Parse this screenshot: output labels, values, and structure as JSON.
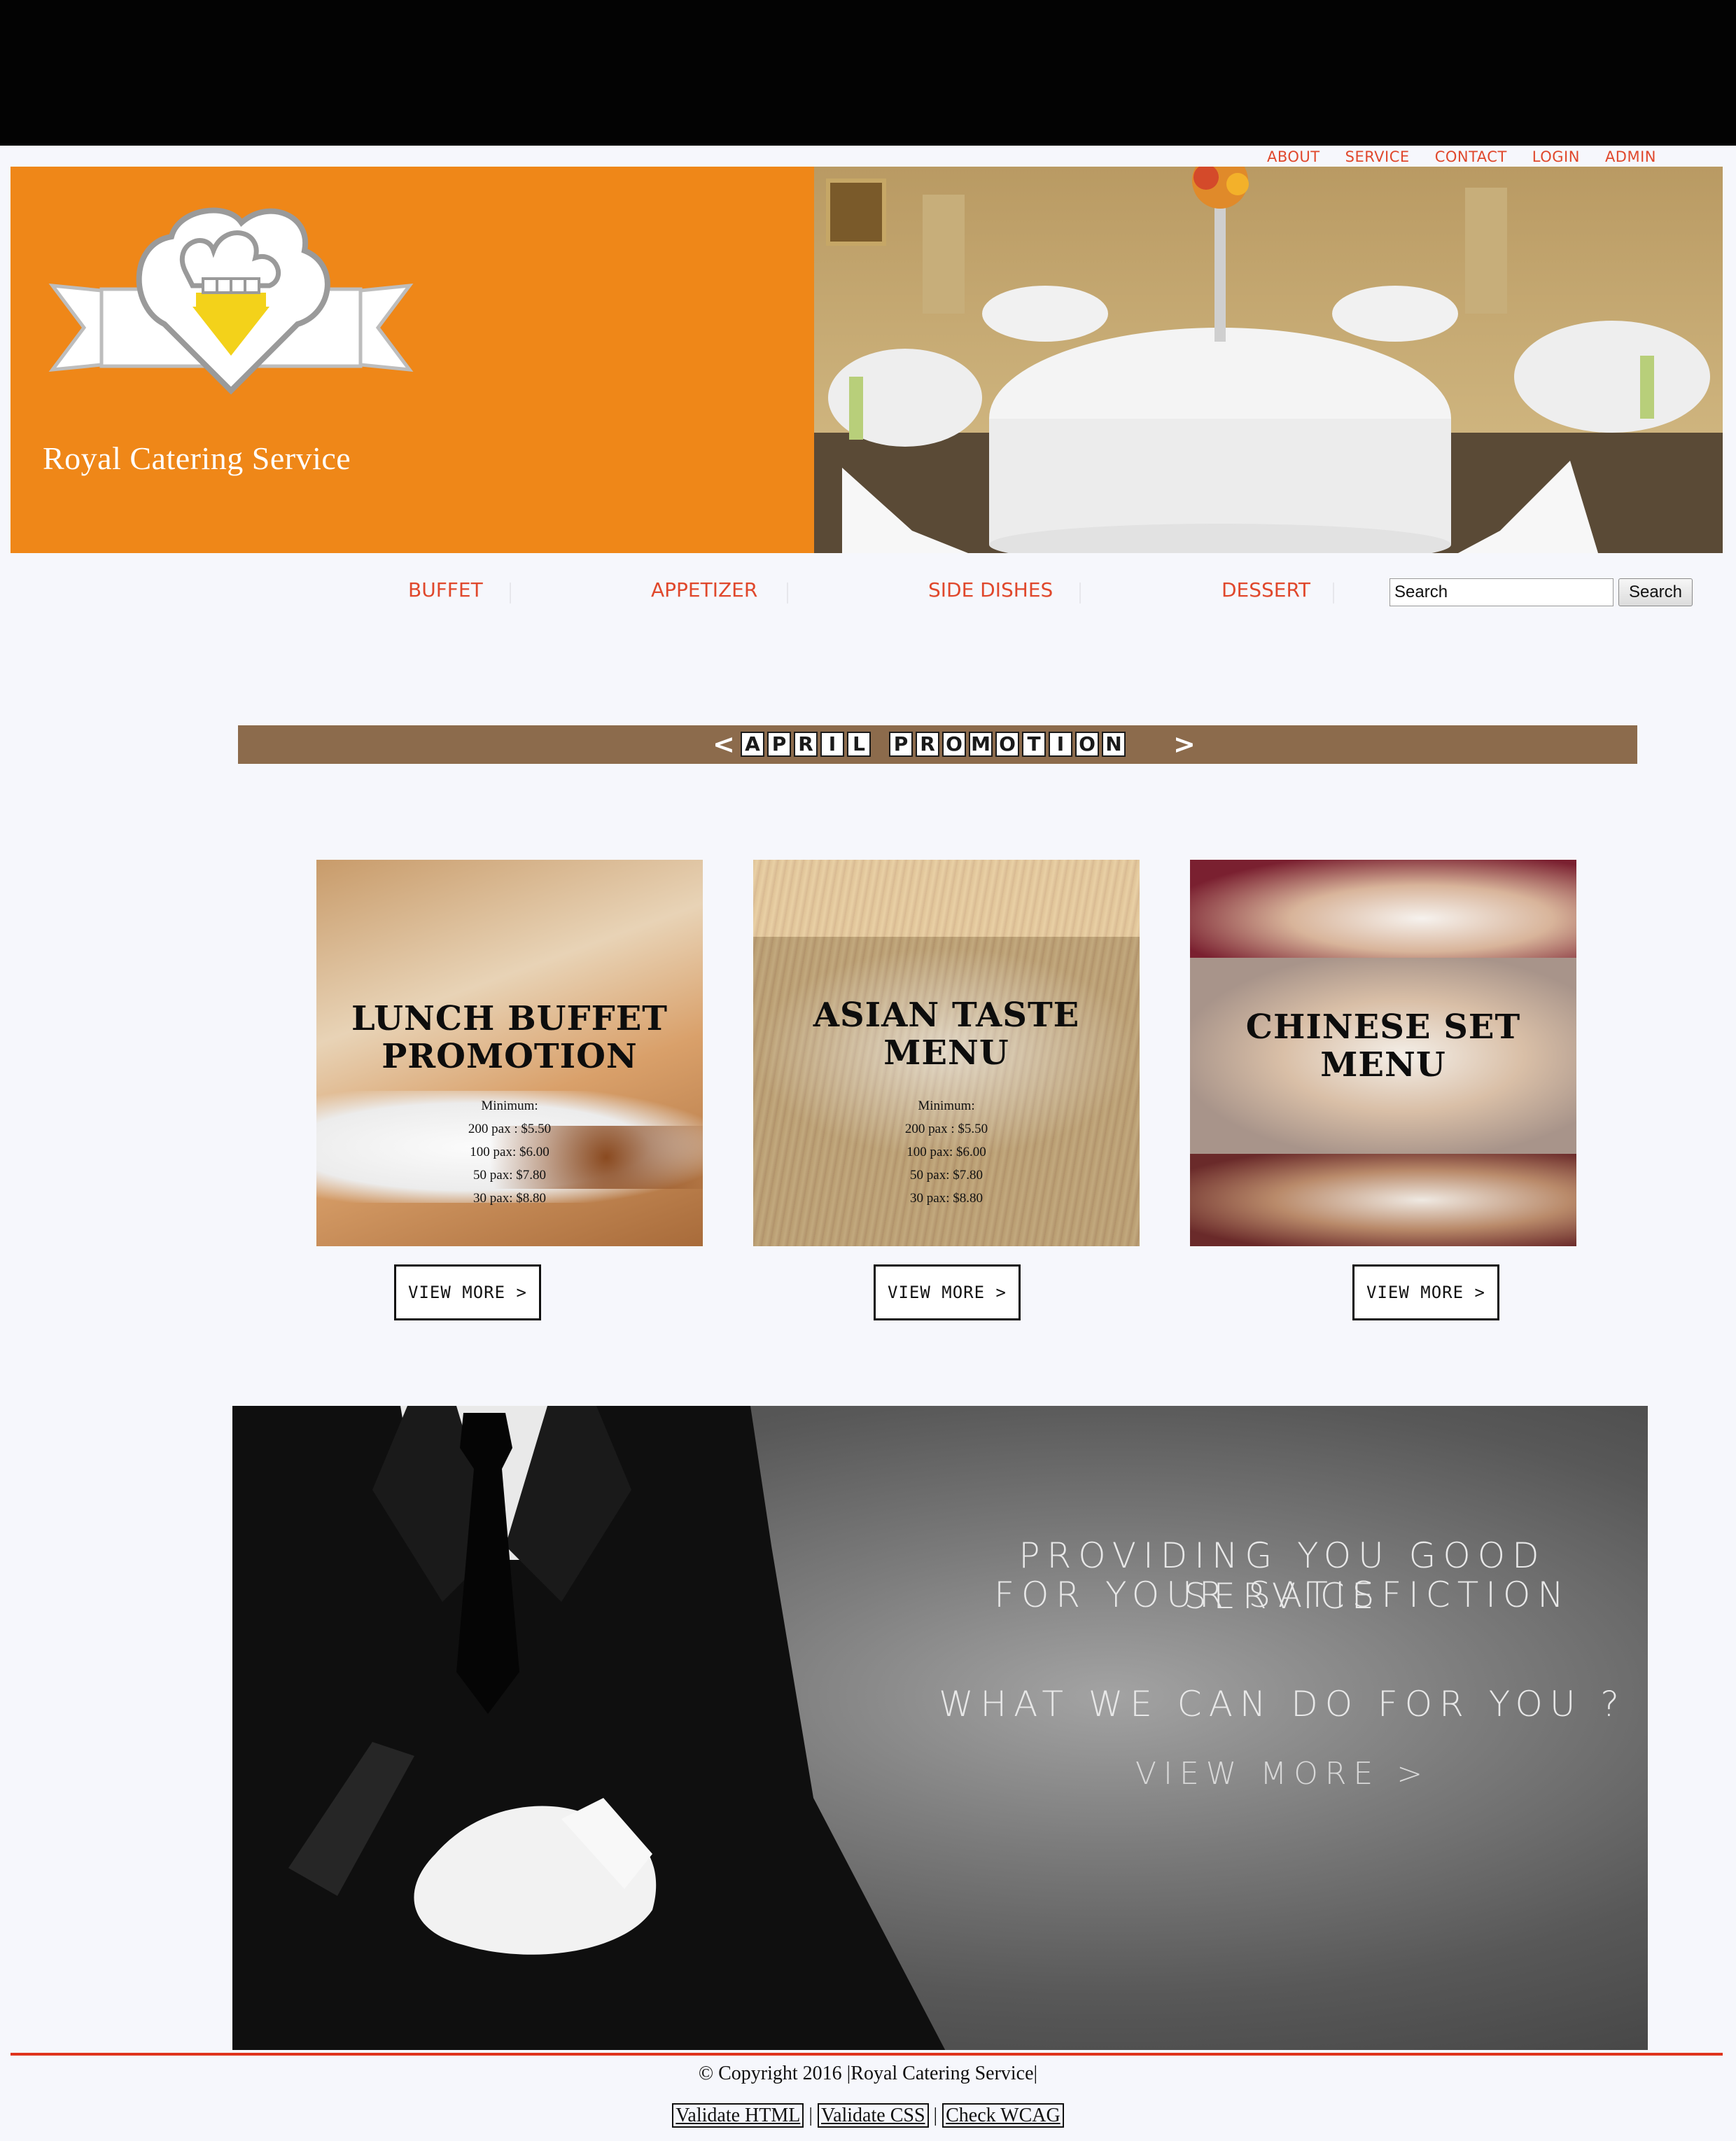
{
  "top_nav": {
    "items": [
      "ABOUT",
      "SERVICE",
      "CONTACT",
      "LOGIN",
      "ADMIN"
    ]
  },
  "banner": {
    "brand": "Royal Catering Service"
  },
  "category_nav": {
    "items": [
      "BUFFET",
      "APPETIZER",
      "SIDE DISHES",
      "DESSERT"
    ]
  },
  "search": {
    "placeholder": "Search",
    "button_label": "Search"
  },
  "promo": {
    "left_arrow": "<",
    "word1": "APRIL",
    "word2": "PROMOTION",
    "right_arrow": ">"
  },
  "cards": [
    {
      "title_line1": "LUNCH BUFFET",
      "title_line2": "PROMOTION",
      "details": [
        "Minimum:",
        "200 pax : $5.50",
        "100 pax: $6.00",
        "50 pax: $7.80",
        "30 pax: $8.80"
      ],
      "button": "VIEW MORE >"
    },
    {
      "title_line1": "ASIAN TASTE",
      "title_line2": "MENU",
      "details": [
        "Minimum:",
        "200 pax : $5.50",
        "100 pax: $6.00",
        "50 pax: $7.80",
        "30 pax: $8.80"
      ],
      "button": "VIEW MORE >"
    },
    {
      "title_line1": "CHINESE SET",
      "title_line2": "MENU",
      "details": [],
      "button": "VIEW MORE >"
    }
  ],
  "service": {
    "line1": "PROVIDING YOU GOOD SERVICE",
    "line2": "FOR YOUR SATISFICTION",
    "line3": "WHAT WE CAN DO FOR YOU ?",
    "link": "VIEW MORE >"
  },
  "footer": {
    "copyright": "© Copyright 2016 |Royal Catering Service|",
    "links": [
      "Validate HTML",
      "Validate CSS",
      "Check WCAG"
    ],
    "separator": "|"
  },
  "colors": {
    "accent_orange": "#ef8718",
    "nav_red": "#e0482c",
    "promo_brown": "#8c6b4c",
    "footer_rule": "#e0341c"
  }
}
